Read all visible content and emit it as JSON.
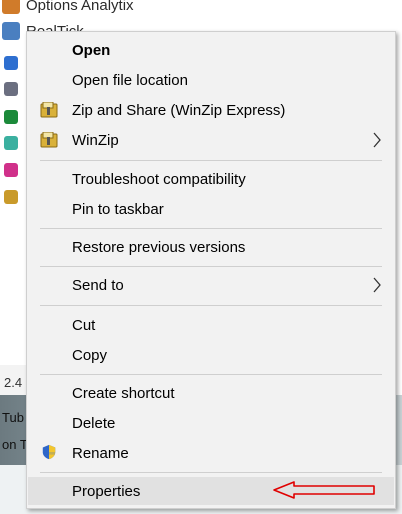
{
  "background": {
    "top_item_1": "Options Analytix",
    "top_item_2": "RealTick",
    "side_text": "2.4",
    "strip_text_1": "Tub",
    "strip_text_2": "on T"
  },
  "context_menu": {
    "items": [
      {
        "label": "Open",
        "bold": true
      },
      {
        "label": "Open file location"
      },
      {
        "label": "Zip and Share (WinZip Express)",
        "icon": "winzip-icon"
      },
      {
        "label": "WinZip",
        "icon": "winzip-icon",
        "submenu": true
      },
      {
        "label": "Troubleshoot compatibility"
      },
      {
        "label": "Pin to taskbar"
      },
      {
        "label": "Restore previous versions"
      },
      {
        "label": "Send to",
        "submenu": true
      },
      {
        "label": "Cut"
      },
      {
        "label": "Copy"
      },
      {
        "label": "Create shortcut"
      },
      {
        "label": "Delete"
      },
      {
        "label": "Rename",
        "icon": "shield-icon"
      },
      {
        "label": "Properties",
        "highlighted": true
      }
    ]
  },
  "annotation": {
    "arrow_color": "#e00000",
    "points_to": "Properties"
  },
  "colors": {
    "menu_bg": "#f2f2f2",
    "highlight": "#e1e1e1",
    "separator": "#cfcfcf"
  }
}
